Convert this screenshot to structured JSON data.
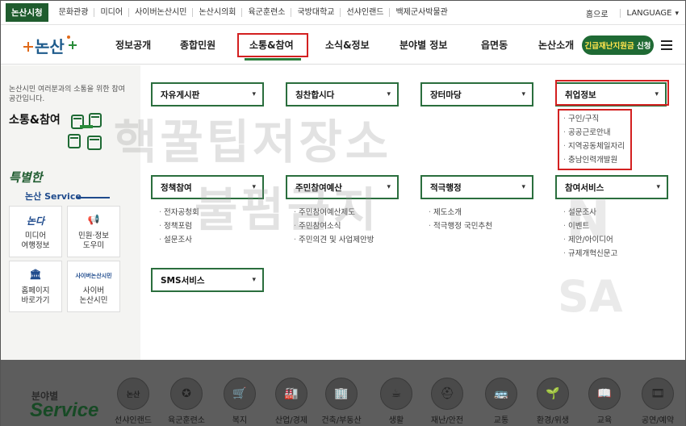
{
  "topbar": {
    "links": [
      "논산시청",
      "문화관광",
      "미디어",
      "사이버논산시민",
      "논산시의회",
      "육군훈련소",
      "국방대학교",
      "선샤인랜드",
      "백제군사박물관"
    ],
    "home": "홈으로",
    "language": "LANGUAGE"
  },
  "gnb": {
    "logo_text": "논산",
    "menu": [
      "정보공개",
      "종합민원",
      "소통&참여",
      "소식&정보",
      "분야별 정보",
      "읍면동",
      "논산소개"
    ],
    "emergency_prefix": "긴급재난지원금",
    "emergency_suffix": "신청"
  },
  "leftpanel": {
    "desc": "논산시민 여러분과의 소통을 위한 참여공간입니다.",
    "title": "소통&참여",
    "special": "특별한",
    "special_sub": "논산 Service",
    "boxes": [
      {
        "icon": "논다",
        "label1": "미디어",
        "label2": "여행정보"
      },
      {
        "icon": "📢",
        "label1": "민원·정보",
        "label2": "도우미"
      },
      {
        "icon": "🏛",
        "label1": "홈페이지",
        "label2": "바로가기"
      },
      {
        "icon": "사이버논산시민",
        "label1": "사이버",
        "label2": "논산시민"
      }
    ]
  },
  "mega": {
    "categories": [
      {
        "label": "자유게시판",
        "subs": []
      },
      {
        "label": "칭찬합시다",
        "subs": []
      },
      {
        "label": "장터마당",
        "subs": []
      },
      {
        "label": "취업정보",
        "subs": [
          "구인/구직",
          "공공근로안내",
          "지역공동체일자리",
          "충남인력개발원"
        ]
      },
      {
        "label": "정책참여",
        "subs": [
          "전자공청회",
          "정책포럼",
          "설문조사"
        ]
      },
      {
        "label": "주민참여예산",
        "subs": [
          "주민참여예산제도",
          "주민참여소식",
          "주민의견 및 사업제안방"
        ]
      },
      {
        "label": "적극행정",
        "subs": [
          "제도소개",
          "적극행정 국민추천"
        ]
      },
      {
        "label": "참여서비스",
        "subs": [
          "설문조사",
          "이벤트",
          "제안/아이디어",
          "규제개혁신문고"
        ]
      },
      {
        "label": "SMS서비스",
        "subs": []
      }
    ]
  },
  "watermark": {
    "line1": "핵꿀팁저장소",
    "line2": "불펌금지"
  },
  "bottom": {
    "title1": "분야별",
    "title2": "Service",
    "items": [
      {
        "icon": "논산",
        "label": "선샤인랜드"
      },
      {
        "icon": "✪",
        "label": "육군훈련소"
      },
      {
        "icon": "🛒",
        "label": "복지"
      },
      {
        "icon": "🏭",
        "label": "산업/경제"
      },
      {
        "icon": "🏢",
        "label": "건축/부동산"
      },
      {
        "icon": "☕",
        "label": "생활"
      },
      {
        "icon": "⛑",
        "label": "재난/안전"
      },
      {
        "icon": "🚌",
        "label": "교통"
      },
      {
        "icon": "🌱",
        "label": "환경/위생"
      },
      {
        "icon": "📖",
        "label": "교육"
      },
      {
        "icon": "🎞",
        "label": "공연/예약"
      }
    ]
  }
}
